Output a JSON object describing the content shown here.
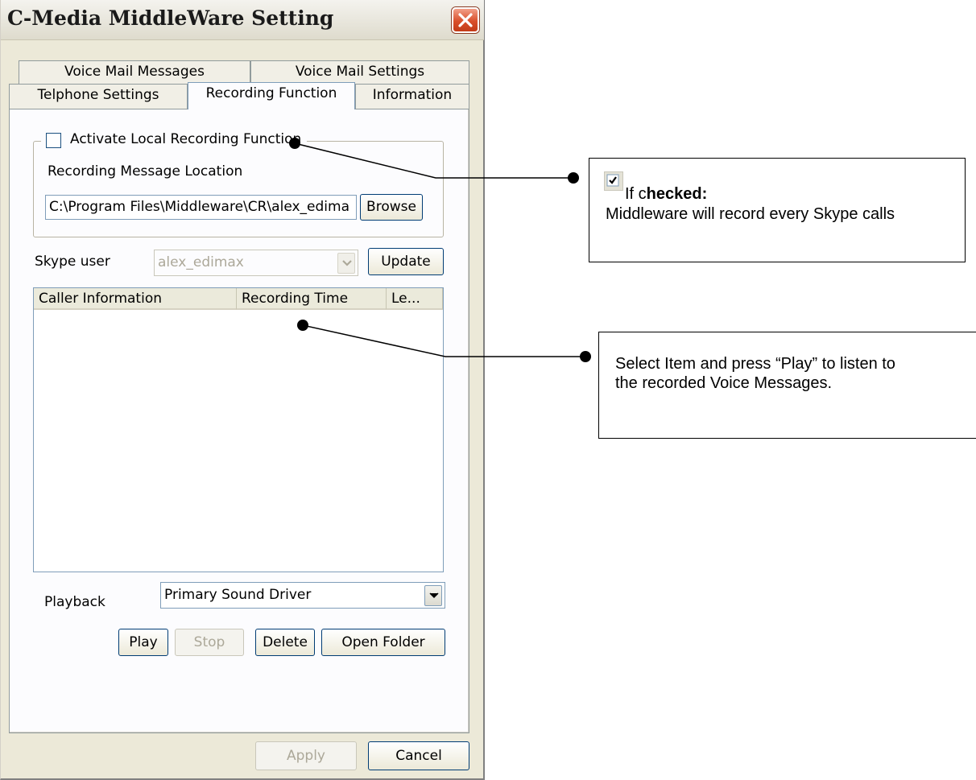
{
  "window": {
    "title": "C-Media MiddleWare Setting"
  },
  "tabs": {
    "row1": [
      "Voice Mail Messages",
      "Voice Mail Settings"
    ],
    "row2": [
      "Telphone Settings",
      "Recording Function",
      "Information"
    ],
    "active": "Recording Function"
  },
  "recording": {
    "activate_label": "Activate Local Recording Function",
    "activate_checked": false,
    "location_label": "Recording Message Location",
    "location_value": "C:\\Program Files\\Middleware\\CR\\alex_edima",
    "browse_label": "Browse"
  },
  "skype_user": {
    "label": "Skype user",
    "value": "alex_edimax",
    "update_label": "Update"
  },
  "list": {
    "columns": [
      "Caller Information",
      "Recording Time",
      "Le..."
    ],
    "rows": []
  },
  "playback": {
    "label": "Playback",
    "value": "Primary Sound Driver"
  },
  "buttons": {
    "play": "Play",
    "stop": "Stop",
    "delete": "Delete",
    "open_folder": "Open Folder",
    "apply": "Apply",
    "cancel": "Cancel"
  },
  "callouts": {
    "checked_prefix": "If c",
    "checked_bold": "hecked:",
    "checked_body": "Middleware will record every Skype calls",
    "play_hint": "Select Item and press “Play” to listen to the recorded Voice Messages."
  },
  "icons": {
    "close": "close-x-icon",
    "dropdown": "chevron-down-icon",
    "checkbox": "checkbox-checked-icon"
  },
  "colors": {
    "close_button": "#d94f2b",
    "dialog_face": "#ece9d8"
  }
}
